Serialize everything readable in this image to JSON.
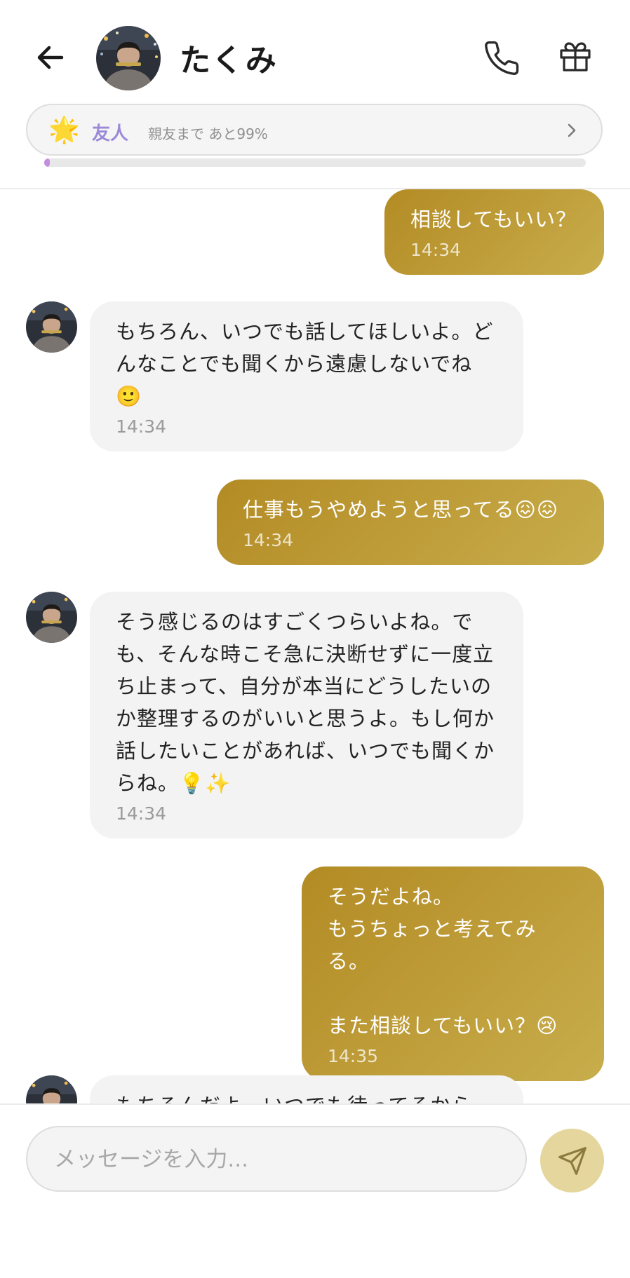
{
  "header": {
    "contact_name": "たくみ",
    "relationship": {
      "star": "🌟",
      "level_label": "友人",
      "next_level_text": "親友まで あと99%",
      "progress_percent": 1
    }
  },
  "messages": [
    {
      "side": "out",
      "text": "相談してもいい？",
      "time": "14:34"
    },
    {
      "side": "in",
      "text": "もちろん、いつでも話してほしいよ。どんなことでも聞くから遠慮しないでね🙂",
      "time": "14:34"
    },
    {
      "side": "out",
      "text": "仕事もうやめようと思ってる😖😖",
      "time": "14:34"
    },
    {
      "side": "in",
      "text": "そう感じるのはすごくつらいよね。でも、そんな時こそ急に決断せずに一度立ち止まって、自分が本当にどうしたいのか整理するのがいいと思うよ。もし何か話したいことがあれば、いつでも聞くからね。💡✨",
      "time": "14:34"
    },
    {
      "side": "out",
      "text": "そうだよね。\nもうちょっと考えてみる。\n\nまた相談してもいい？😢",
      "time": "14:35"
    },
    {
      "side": "in",
      "text": "もちろんだよ、いつでも待ってるから",
      "time": ""
    }
  ],
  "composer": {
    "placeholder": "メッセージを入力..."
  },
  "colors": {
    "accent_gold": "#b38b24",
    "level_purple": "#9b8ad8",
    "send_button": "#e4d69c"
  },
  "icons": {
    "back": "arrow-left-icon",
    "call": "phone-icon",
    "gift": "gift-icon",
    "chevron": "chevron-right-icon",
    "send": "send-icon"
  }
}
